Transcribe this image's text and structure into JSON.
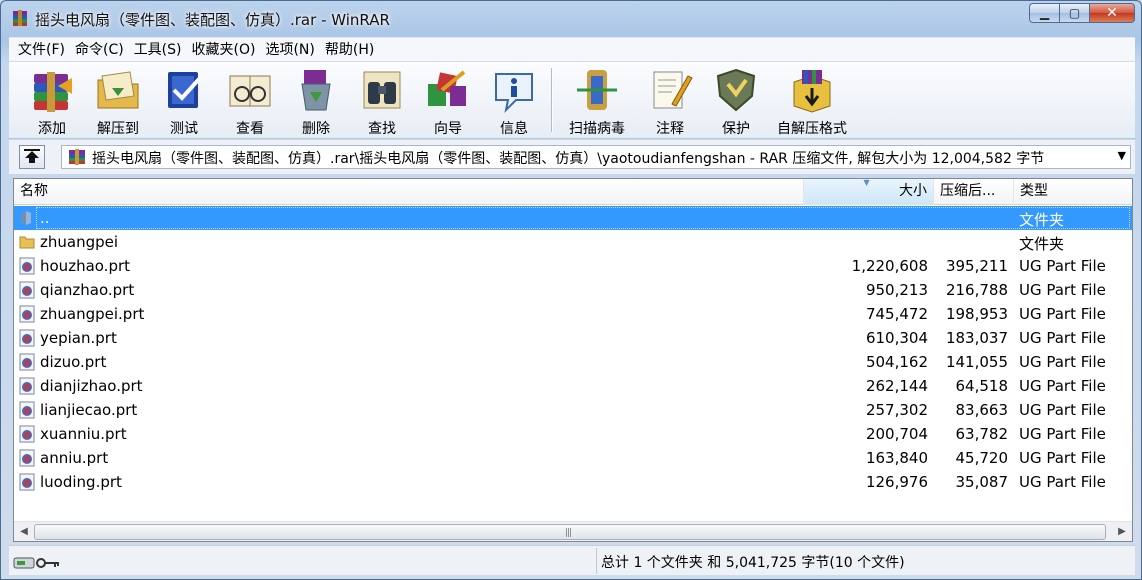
{
  "window": {
    "title": "摇头电风扇（零件图、装配图、仿真）.rar - WinRAR"
  },
  "menu": [
    "文件(F)",
    "命令(C)",
    "工具(S)",
    "收藏夹(O)",
    "选项(N)",
    "帮助(H)"
  ],
  "toolbar": {
    "add": "添加",
    "extract": "解压到",
    "test": "测试",
    "view": "查看",
    "delete": "删除",
    "find": "查找",
    "wizard": "向导",
    "info": "信息",
    "scan": "扫描病毒",
    "comment": "注释",
    "protect": "保护",
    "sfx": "自解压格式"
  },
  "address": {
    "path": "摇头电风扇（零件图、装配图、仿真）.rar\\摇头电风扇（零件图、装配图、仿真）\\yaotoudianfengshan - RAR 压缩文件, 解包大小为 12,004,582 字节"
  },
  "columns": {
    "name": "名称",
    "size": "大小",
    "packed": "压缩后...",
    "type": "类型"
  },
  "files": [
    {
      "name": "..",
      "size": "",
      "packed": "",
      "type": "文件夹"
    },
    {
      "name": "zhuangpei",
      "size": "",
      "packed": "",
      "type": "文件夹"
    },
    {
      "name": "houzhao.prt",
      "size": "1,220,608",
      "packed": "395,211",
      "type": "UG Part File"
    },
    {
      "name": "qianzhao.prt",
      "size": "950,213",
      "packed": "216,788",
      "type": "UG Part File"
    },
    {
      "name": "zhuangpei.prt",
      "size": "745,472",
      "packed": "198,953",
      "type": "UG Part File"
    },
    {
      "name": "yepian.prt",
      "size": "610,304",
      "packed": "183,037",
      "type": "UG Part File"
    },
    {
      "name": "dizuo.prt",
      "size": "504,162",
      "packed": "141,055",
      "type": "UG Part File"
    },
    {
      "name": "dianjizhao.prt",
      "size": "262,144",
      "packed": "64,518",
      "type": "UG Part File"
    },
    {
      "name": "lianjiecao.prt",
      "size": "257,302",
      "packed": "83,663",
      "type": "UG Part File"
    },
    {
      "name": "xuanniu.prt",
      "size": "200,704",
      "packed": "63,782",
      "type": "UG Part File"
    },
    {
      "name": "anniu.prt",
      "size": "163,840",
      "packed": "45,720",
      "type": "UG Part File"
    },
    {
      "name": "luoding.prt",
      "size": "126,976",
      "packed": "35,087",
      "type": "UG Part File"
    }
  ],
  "status": {
    "summary": "总计 1 个文件夹 和 5,041,725 字节(10 个文件)"
  },
  "colors": {
    "selection": "#3399ff",
    "close": "#c23a20",
    "folder": "#e8c05a"
  }
}
